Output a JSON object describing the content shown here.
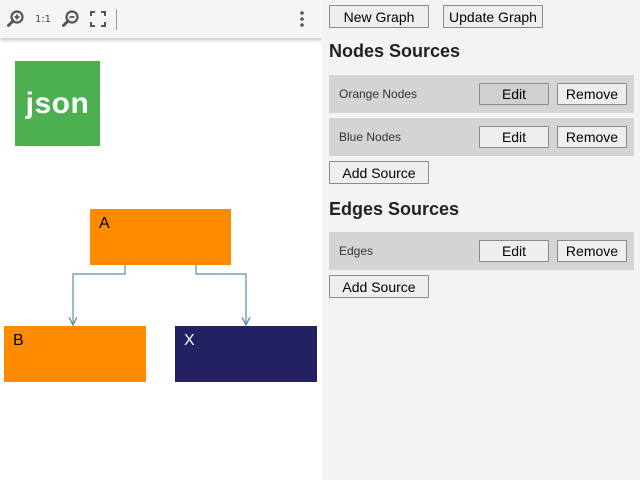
{
  "toolbar": {
    "zoom_in_icon": "zoom-in-icon",
    "actual_size_label": "1:1",
    "zoom_out_icon": "zoom-out-icon",
    "fit_icon": "fullscreen-icon",
    "menu_icon": "more-vert-icon"
  },
  "logo": {
    "text": "json",
    "color": "#4caf50"
  },
  "graph": {
    "nodes": [
      {
        "id": "A",
        "label": "A",
        "color": "#ff8c00",
        "text_color": "#000000"
      },
      {
        "id": "B",
        "label": "B",
        "color": "#ff8c00",
        "text_color": "#000000"
      },
      {
        "id": "X",
        "label": "X",
        "color": "#232162",
        "text_color": "#ffffff"
      }
    ],
    "edges": [
      {
        "from": "A",
        "to": "B"
      },
      {
        "from": "A",
        "to": "X"
      }
    ],
    "edge_color": "#5b8fa8"
  },
  "header": {
    "new_graph_label": "New Graph",
    "update_graph_label": "Update Graph"
  },
  "nodes_sources": {
    "title": "Nodes Sources",
    "items": [
      {
        "name": "Orange Nodes",
        "edit_label": "Edit",
        "remove_label": "Remove"
      },
      {
        "name": "Blue Nodes",
        "edit_label": "Edit",
        "remove_label": "Remove"
      }
    ],
    "add_label": "Add Source"
  },
  "edges_sources": {
    "title": "Edges Sources",
    "items": [
      {
        "name": "Edges",
        "edit_label": "Edit",
        "remove_label": "Remove"
      }
    ],
    "add_label": "Add Source"
  }
}
